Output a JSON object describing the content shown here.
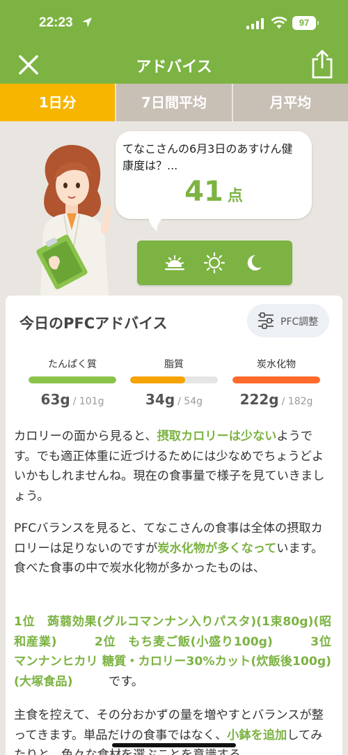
{
  "status_bar": {
    "time": "22:23",
    "battery": "97"
  },
  "header": {
    "title": "アドバイス",
    "close_icon": "close-icon",
    "share_icon": "share-icon"
  },
  "tabs": [
    {
      "label": "1日分",
      "active": true
    },
    {
      "label": "7日間平均",
      "active": false
    },
    {
      "label": "月平均",
      "active": false
    }
  ],
  "hero": {
    "question": "てなこさんの6月3日のあすけん健康度は？...",
    "score": "41",
    "score_unit": "点",
    "time_icons": [
      "sunrise-icon",
      "sun-icon",
      "moon-icon"
    ]
  },
  "pfc": {
    "title": "今日のPFCアドバイス",
    "adjust_label": "PFC調整",
    "nutrients": [
      {
        "name": "たんぱく質",
        "value": "63g",
        "target": "/ 101g",
        "progress": 1.0,
        "color": "#8bc34a"
      },
      {
        "name": "脂質",
        "value": "34g",
        "target": "/ 54g",
        "progress": 0.63,
        "color": "#f5a300"
      },
      {
        "name": "炭水化物",
        "value": "222g",
        "target": "/ 182g",
        "progress": 1.0,
        "color": "#ff6a2c"
      }
    ]
  },
  "advice": {
    "p1_a": "カロリーの面から見ると、",
    "p1_hl": "摂取カロリーは少ない",
    "p1_b": "ようです。でも適正体重に近づけるためには少なめでちょうどよいかもしれませんね。現在の食事量で様子を見ていきましょう。",
    "p2_a": "PFCバランスを見ると、てなこさんの食事は全体の摂取カロリーは足りないのですが",
    "p2_hl": "炭水化物が多くなって",
    "p2_b": "います。食べた食事の中で炭水化物が多かったものは、",
    "rank1": "1位　蒟蒻効果(グルコマンナン入りパスタ)(1束80g)(昭和産業)",
    "rank2": "2位　もち麦ご飯(小盛り100g)",
    "rank3": "3位　マンナンヒカリ 糖質・カロリー30%カット(炊飯後100g)(大塚食品)",
    "rank_tail": "です。",
    "p4_a": "主食を控えて、その分おかずの量を増やすとバランスが整ってきます。単品だけの食事ではなく、",
    "p4_hl": "小鉢を追加",
    "p4_b": "してみたりと、色々な食材を選ぶことを意識する"
  },
  "colors": {
    "brand_green": "#7cb342",
    "tab_active": "#f7b500",
    "tab_inactive": "#c8bfb5"
  }
}
